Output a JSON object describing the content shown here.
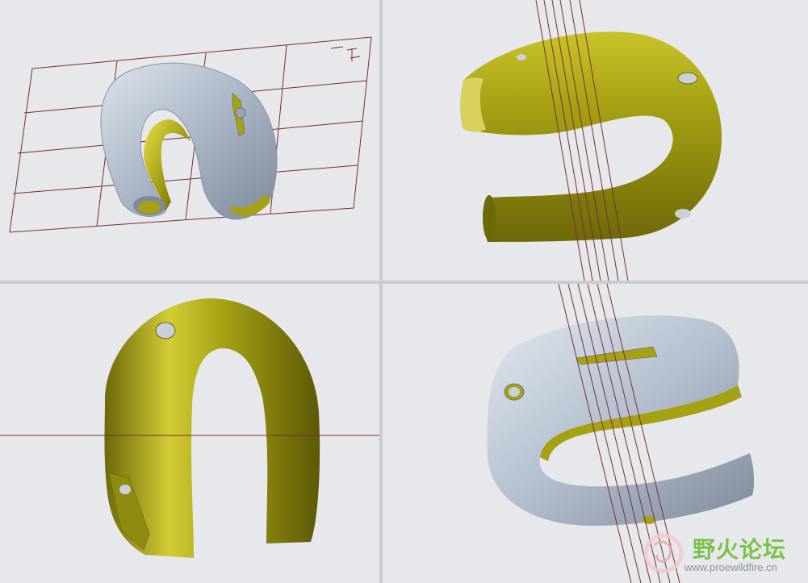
{
  "app": {
    "toolbar": {
      "buttons": [
        {
          "icon": "zoom-icon",
          "glyph": "🔍"
        },
        {
          "icon": "select-arrow-icon",
          "glyph": "↖"
        },
        {
          "icon": "select-arrow-2-icon",
          "glyph": "↖"
        },
        {
          "icon": "repaint-icon",
          "glyph": "◩"
        },
        {
          "icon": "orient-view-icon",
          "glyph": "▢"
        },
        {
          "icon": "saved-views-icon",
          "glyph": "▤"
        },
        {
          "icon": "view-manager-icon",
          "glyph": "▣"
        },
        {
          "icon": "annotation-icon",
          "glyph": "ᚾ"
        },
        {
          "icon": "display-style-icon",
          "glyph": "◉"
        },
        {
          "icon": "datum-axis-icon",
          "glyph": "⤢"
        },
        {
          "icon": "datum-point-icon",
          "glyph": "◉"
        },
        {
          "icon": "layout-icon",
          "glyph": "◫"
        },
        {
          "icon": "sketch-icon",
          "glyph": "⟋"
        },
        {
          "icon": "window-icon",
          "glyph": "▭"
        },
        {
          "icon": "spin-icon",
          "glyph": "✳"
        }
      ]
    },
    "viewports": [
      {
        "name": "top-left-view"
      },
      {
        "name": "top-right-view"
      },
      {
        "name": "bottom-left-view"
      },
      {
        "name": "bottom-right-view"
      }
    ],
    "datum_label": "⊼ ℸ ⌶",
    "colors": {
      "background": "#e6e8eb",
      "shell_yellow": "#a6a112",
      "shell_blue": "#b3bfcf",
      "datum_lines": "#7a2a3a"
    },
    "watermark": {
      "title": "野火论坛",
      "url": "www.proewildfire.cn"
    }
  }
}
